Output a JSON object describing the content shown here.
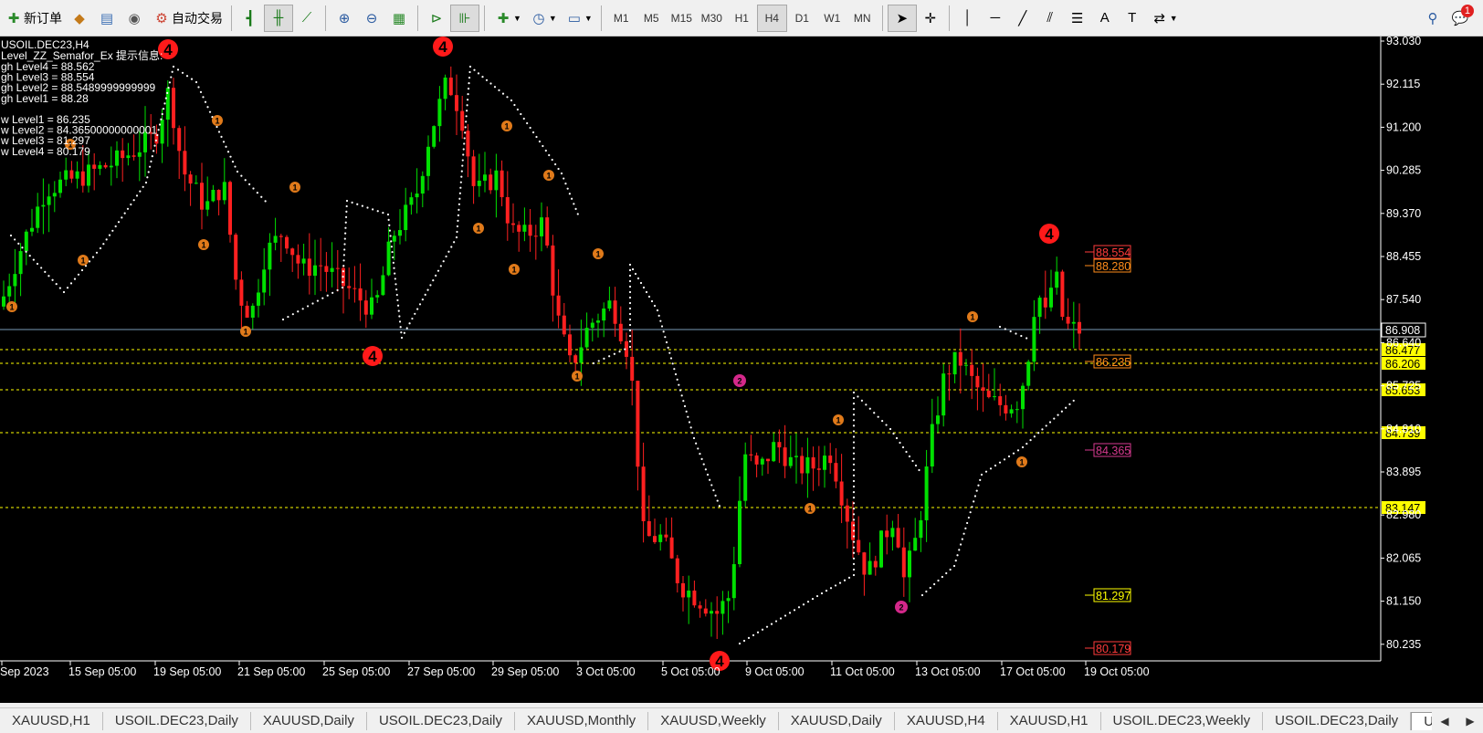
{
  "toolbar": {
    "new_order_label": "新订单",
    "auto_trade_label": "自动交易",
    "timeframes": [
      "M1",
      "M5",
      "M15",
      "M30",
      "H1",
      "H4",
      "D1",
      "W1",
      "MN"
    ],
    "active_timeframe": "H4",
    "notification_count": "1"
  },
  "chart": {
    "title": "USOIL.DEC23,H4",
    "indicator_header": "Level_ZZ_Semafor_Ex 提示信息:",
    "info_lines": [
      "gh Level4 = 88.562",
      "gh Level3 = 88.554",
      "gh Level2 = 88.5489999999999",
      "gh Level1 = 88.28",
      "",
      "w Level1 = 86.235",
      "w Level2 = 84.36500000000001",
      "w Level3 = 81.297",
      "w Level4 = 80.179"
    ],
    "price_axis": [
      "93.030",
      "92.115",
      "91.200",
      "90.285",
      "89.370",
      "88.455",
      "87.540",
      "86.640",
      "85.725",
      "84.810",
      "83.895",
      "82.980",
      "82.065",
      "81.150",
      "80.235"
    ],
    "date_labels": [
      "Sep 2023",
      "15 Sep 05:00",
      "19 Sep 05:00",
      "21 Sep 05:00",
      "25 Sep 05:00",
      "27 Sep 05:00",
      "29 Sep 05:00",
      "3 Oct 05:00",
      "5 Oct 05:00",
      "9 Oct 05:00",
      "11 Oct 05:00",
      "13 Oct 05:00",
      "17 Oct 05:00",
      "19 Oct 05:00"
    ],
    "current_price": "86.908",
    "hline_labels": [
      "86.477",
      "86.206",
      "85.653",
      "84.739",
      "83.147"
    ],
    "level_labels": [
      {
        "text": "88.554",
        "color": "#ff3b3b"
      },
      {
        "text": "88.280",
        "color": "#ff8c1a"
      },
      {
        "text": "86.235",
        "color": "#ff8c1a"
      },
      {
        "text": "84.365",
        "color": "#d63a8f"
      },
      {
        "text": "81.297",
        "color": "#ffff00"
      },
      {
        "text": "80.179",
        "color": "#ff3b3b"
      }
    ],
    "colors": {
      "bull": "#00e000",
      "bear": "#ff2020",
      "hline": "#ffff00",
      "current": "#7a9bb8"
    }
  },
  "tabs": [
    "XAUUSD,H1",
    "USOIL.DEC23,Daily",
    "XAUUSD,Daily",
    "USOIL.DEC23,Daily",
    "XAUUSD,Monthly",
    "XAUUSD,Weekly",
    "XAUUSD,Daily",
    "XAUUSD,H4",
    "XAUUSD,H1",
    "USOIL.DEC23,Weekly",
    "USOIL.DEC23,Daily",
    "U"
  ]
}
